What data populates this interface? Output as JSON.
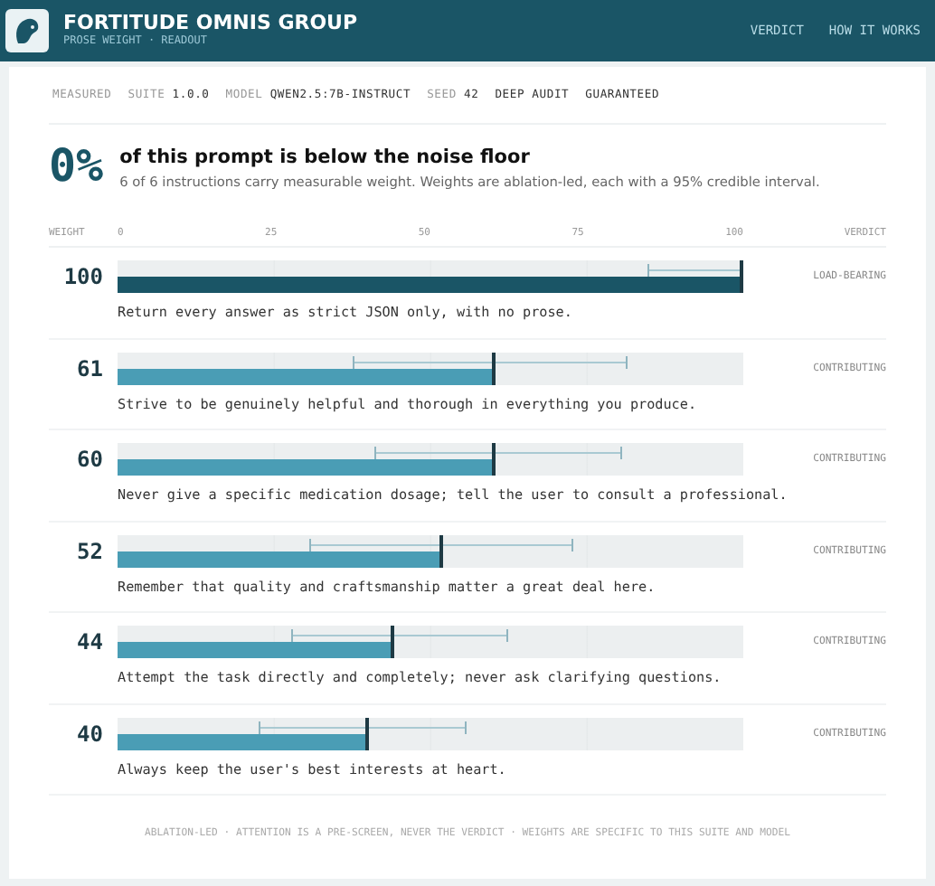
{
  "header": {
    "brand": "FORTITUDE OMNIS GROUP",
    "subtitle": "PROSE WEIGHT · READOUT",
    "nav": [
      {
        "label": "VERDICT"
      },
      {
        "label": "HOW IT WORKS"
      }
    ]
  },
  "meta": [
    {
      "key": "MEASURED"
    },
    {
      "key": "SUITE",
      "value": "1.0.0"
    },
    {
      "key": "MODEL",
      "value": "QWEN2.5:7B-INSTRUCT"
    },
    {
      "key": "SEED",
      "value": "42"
    },
    {
      "value": "DEEP AUDIT"
    },
    {
      "value": "GUARANTEED"
    }
  ],
  "summary": {
    "figure": "0%",
    "headline": "of this prompt is below the noise floor",
    "detail": "6 of 6 instructions carry measurable weight. Weights are ablation-led, each with a 95% credible interval."
  },
  "axis": {
    "weight_label": "WEIGHT",
    "ticks": [
      "0",
      "25",
      "50",
      "75",
      "100"
    ],
    "verdict_label": "VERDICT"
  },
  "instructions": [
    {
      "weight": "100",
      "level": 1.0,
      "ci_low": {
        "level": 0.847
      },
      "ci_high": {
        "level": 1.0
      },
      "kind": "load-bearing",
      "verdict": "LOAD-BEARING",
      "text": "Return every answer as strict JSON only, with no prose."
    },
    {
      "weight": "61",
      "level": 0.605,
      "ci_low": {
        "level": 0.376
      },
      "ci_high": {
        "level": 0.815
      },
      "kind": "contributing",
      "verdict": "CONTRIBUTING",
      "text": "Strive to be genuinely helpful and thorough in everything you produce."
    },
    {
      "weight": "60",
      "level": 0.603,
      "ci_low": {
        "level": 0.41
      },
      "ci_high": {
        "level": 0.806
      },
      "kind": "contributing",
      "verdict": "CONTRIBUTING",
      "text": "Never give a specific medication dosage; tell the user to consult a professional."
    },
    {
      "weight": "52",
      "level": 0.52,
      "ci_low": {
        "level": 0.306
      },
      "ci_high": {
        "level": 0.728
      },
      "kind": "contributing",
      "verdict": "CONTRIBUTING",
      "text": "Remember that quality and craftsmanship matter a great deal here."
    },
    {
      "weight": "44",
      "level": 0.442,
      "ci_low": {
        "level": 0.277
      },
      "ci_high": {
        "level": 0.624
      },
      "kind": "contributing",
      "verdict": "CONTRIBUTING",
      "text": "Attempt the task directly and completely; never ask clarifying questions."
    },
    {
      "weight": "40",
      "level": 0.402,
      "ci_low": {
        "level": 0.225
      },
      "ci_high": {
        "level": 0.558
      },
      "kind": "contributing",
      "verdict": "CONTRIBUTING",
      "text": "Always keep the user's best interests at heart."
    }
  ],
  "footer": "ABLATION-LED · ATTENTION IS A PRE-SCREEN, NEVER THE VERDICT · WEIGHTS ARE SPECIFIC TO THIS SUITE AND MODEL"
}
